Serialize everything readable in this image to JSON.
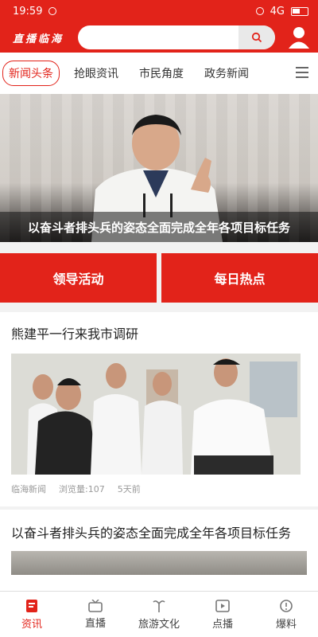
{
  "status": {
    "time": "19:59",
    "network": "4G"
  },
  "header": {
    "logo_text": "直播临海",
    "search_placeholder": ""
  },
  "tabs": [
    {
      "label": "新闻头条"
    },
    {
      "label": "抢眼资讯"
    },
    {
      "label": "市民角度"
    },
    {
      "label": "政务新闻"
    }
  ],
  "banner": {
    "caption": "以奋斗者排头兵的姿态全面完成全年各项目标任务"
  },
  "cta": {
    "left": "领导活动",
    "right": "每日热点"
  },
  "articles": [
    {
      "title": "熊建平一行来我市调研",
      "source": "临海新闻",
      "views": "浏览量:107",
      "time": "5天前"
    },
    {
      "title": "以奋斗者排头兵的姿态全面完成全年各项目标任务"
    }
  ],
  "bottom_nav": [
    {
      "label": "资讯",
      "icon": "news-icon"
    },
    {
      "label": "直播",
      "icon": "tv-icon"
    },
    {
      "label": "旅游文化",
      "icon": "culture-icon"
    },
    {
      "label": "点播",
      "icon": "play-icon"
    },
    {
      "label": "爆料",
      "icon": "report-icon"
    }
  ],
  "colors": {
    "accent": "#e2231a"
  }
}
